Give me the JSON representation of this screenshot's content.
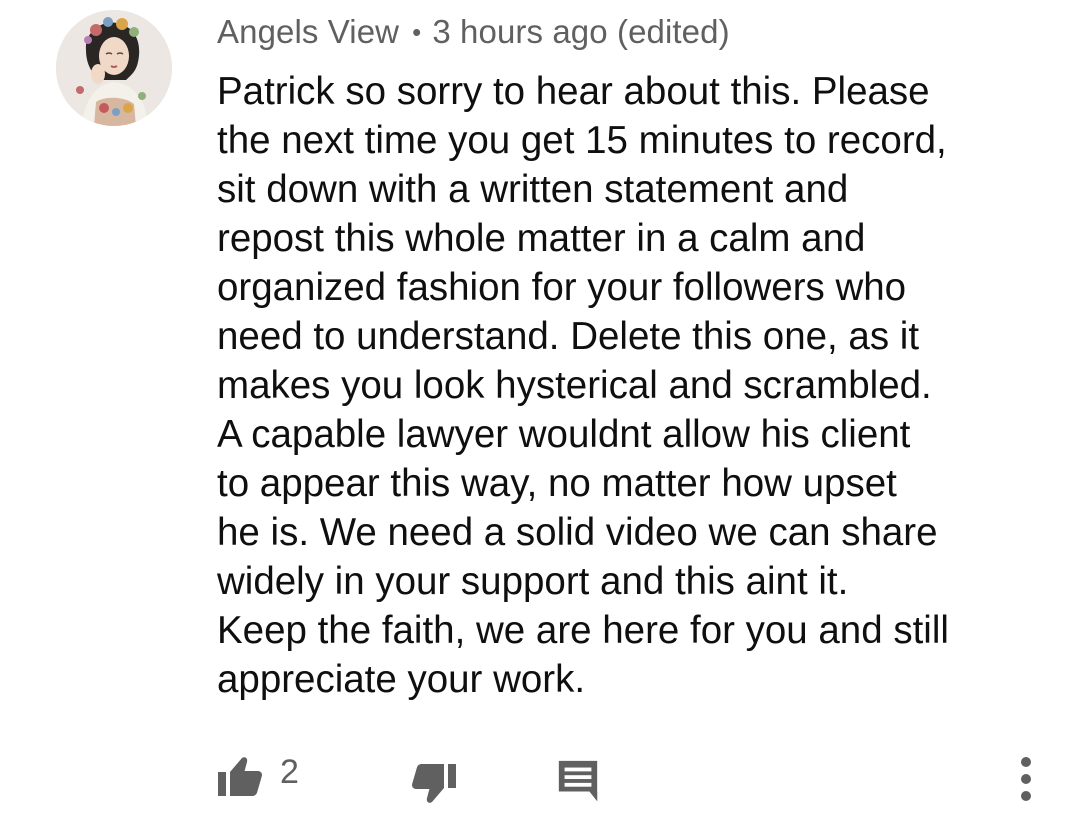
{
  "comment": {
    "author": "Angels View",
    "separator": "•",
    "timestamp": "3 hours ago (edited)",
    "text": "Patrick so sorry to hear about this. Please\nthe next time you get 15 minutes to record,\nsit down with a written statement and\nrepost this whole matter in a calm and\norganized fashion for your followers who\nneed to understand. Delete this one, as it\nmakes you look hysterical and scrambled.\nA capable lawyer wouldnt allow his client\nto appear this way, no matter how upset\nhe is. We need a solid video we can share\nwidely in your support and this aint it.\nKeep the faith, we are here for you and still\nappreciate your work.",
    "like_count": "2"
  },
  "icons": {
    "like": "thumbs-up-icon",
    "dislike": "thumbs-down-icon",
    "reply": "comment-icon",
    "more": "more-vert-icon"
  },
  "colors": {
    "text": "#0f0f0f",
    "secondary": "#606060",
    "icon": "#606060",
    "background": "#ffffff"
  }
}
